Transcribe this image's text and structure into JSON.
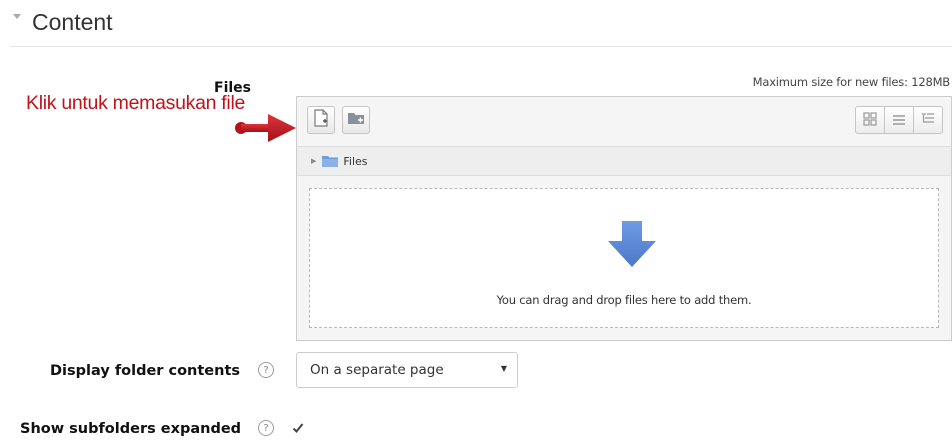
{
  "section": {
    "title": "Content"
  },
  "filemanager": {
    "label": "Files",
    "max_size": "Maximum size for new files: 128MB",
    "path_label": "Files",
    "drop_text": "You can drag and drop files here to add them."
  },
  "annotation": {
    "text": "Klik untuk memasukan file"
  },
  "display": {
    "label": "Display folder contents",
    "help_symbol": "?",
    "selected": "On a separate page"
  },
  "subfolders": {
    "label": "Show subfolders expanded",
    "help_symbol": "?",
    "checked": true
  },
  "colors": {
    "annotation": "#c0121b",
    "drop_arrow": "#5b86d6",
    "folder": "#6e9fdc"
  }
}
